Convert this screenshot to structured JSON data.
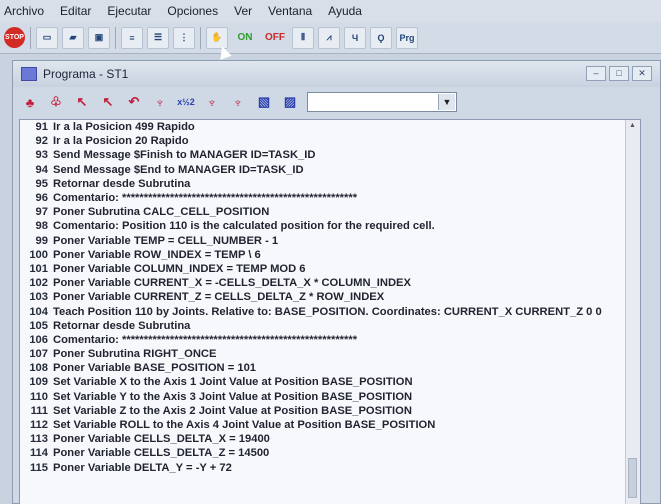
{
  "menu": [
    "Archivo",
    "Editar",
    "Ejecutar",
    "Opciones",
    "Ver",
    "Ventana",
    "Ayuda"
  ],
  "toolbar": {
    "stop_label": "STOP",
    "on_label": "ON",
    "off_label": "OFF",
    "prg_label": "Prg"
  },
  "window": {
    "title": "Programa - ST1"
  },
  "program_toolbar": {
    "combo_value": "",
    "small_label": "x½2"
  },
  "lines": [
    {
      "n": "91",
      "t": "Ir a la Posicion 499 Rapido"
    },
    {
      "n": "92",
      "t": "Ir a la Posicion 20 Rapido"
    },
    {
      "n": "93",
      "t": "Send Message $Finish to MANAGER ID=TASK_ID"
    },
    {
      "n": "94",
      "t": "Send Message $End to MANAGER ID=TASK_ID"
    },
    {
      "n": "95",
      "t": "Retornar desde Subrutina"
    },
    {
      "n": "96",
      "t": "Comentario: ******************************************************"
    },
    {
      "n": "97",
      "t": "Poner Subrutina CALC_CELL_POSITION"
    },
    {
      "n": "98",
      "t": "Comentario: Position 110 is the calculated position for the required cell."
    },
    {
      "n": "99",
      "t": "Poner Variable TEMP  = CELL_NUMBER - 1"
    },
    {
      "n": "100",
      "t": "Poner Variable ROW_INDEX  = TEMP \\ 6"
    },
    {
      "n": "101",
      "t": "Poner Variable COLUMN_INDEX  = TEMP MOD 6"
    },
    {
      "n": "102",
      "t": "Poner Variable CURRENT_X  = -CELLS_DELTA_X * COLUMN_INDEX"
    },
    {
      "n": "103",
      "t": "Poner Variable CURRENT_Z  = CELLS_DELTA_Z * ROW_INDEX"
    },
    {
      "n": "104",
      "t": "Teach Position 110 by Joints. Relative to: BASE_POSITION. Coordinates: CURRENT_X CURRENT_Z 0 0"
    },
    {
      "n": "105",
      "t": "Retornar desde Subrutina"
    },
    {
      "n": "106",
      "t": "Comentario: ******************************************************"
    },
    {
      "n": "107",
      "t": "Poner Subrutina RIGHT_ONCE"
    },
    {
      "n": "108",
      "t": "Poner Variable BASE_POSITION  = 101"
    },
    {
      "n": "109",
      "t": "Set Variable X to the Axis 1 Joint Value at Position BASE_POSITION"
    },
    {
      "n": "110",
      "t": "Set Variable Y to the Axis 3 Joint Value at Position BASE_POSITION"
    },
    {
      "n": "111",
      "t": "Set Variable Z to the Axis 2 Joint Value at Position BASE_POSITION"
    },
    {
      "n": "112",
      "t": "Set Variable ROLL to the Axis 4 Joint Value at Position BASE_POSITION"
    },
    {
      "n": "113",
      "t": "Poner Variable CELLS_DELTA_X  = 19400"
    },
    {
      "n": "114",
      "t": "Poner Variable CELLS_DELTA_Z  = 14500"
    },
    {
      "n": "115",
      "t": "Poner Variable DELTA_Y  = -Y + 72"
    }
  ]
}
